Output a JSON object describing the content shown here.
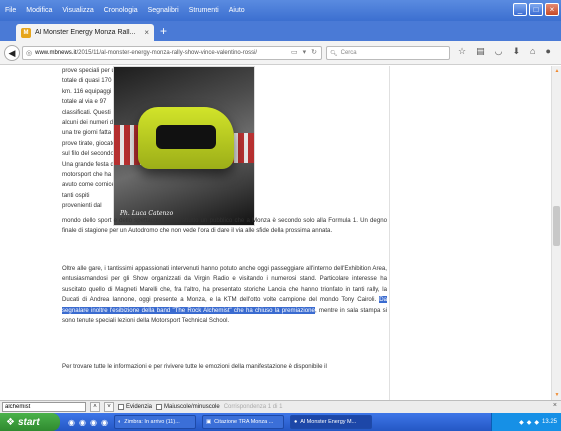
{
  "menu": {
    "items": [
      "File",
      "Modifica",
      "Visualizza",
      "Cronologia",
      "Segnalibri",
      "Strumenti",
      "Aiuto"
    ],
    "underline": [
      "F",
      "M",
      "V",
      "C",
      "S",
      "S",
      "A"
    ]
  },
  "tab": {
    "title": "Al Monster Energy Monza Rall...",
    "close": "×",
    "new_tab": "+"
  },
  "nav": {
    "url_host": "www.mbnews.it",
    "url_path": "/2015/11/al-monster-energy-monza-rally-show-vince-valentino-rossi/",
    "search_placeholder": "Cerca"
  },
  "article": {
    "side_lines": [
      "prove speciali per un",
      "totale di quasi 170",
      "km. 116 equipaggi in",
      "totale al via e 97",
      "classificati. Questi",
      "alcuni dei numeri di",
      "una tre giorni fatta di",
      "prove tirate, giocate",
      "sul filo del secondo.",
      "Una grande festa del",
      "motorsport che ha",
      "avuto come cornice",
      "tanti ospiti",
      "provenienti dal"
    ],
    "photo_credit": "Ph. Luca Catenzo",
    "para1": "mondo dello sport e dello spettacolo e soprattutto un pubblico che a Monza è secondo solo alla Formula 1. Un degno finale di stagione per un Autodromo che non vede l'ora di dare il via alle sfide della prossima annata.",
    "para2_before": "Oltre alle gare, i tantissimi appassionati intervenuti hanno potuto anche oggi passeggiare all'interno dell'Exhibition Area, entusiasmandosi per gli Show organizzati da Virgin Radio e visitando i numerosi stand. Particolare interesse ha suscitato quello di Magneti Marelli che, fra l'altro, ha presentato storiche Lancia che hanno trionfato in tanti rally, la Ducati di Andrea Iannone, oggi presente a Monza, e la KTM dell'otto volte campione del mondo Tony Cairoli. ",
    "para2_highlight": "Da segnalare inoltre l'esibizione della band \"The Rock Alchemist\" che ha chiuso la premiazione",
    "para2_after": ", mentre in sala stampa si sono tenute speciali lezioni della Motorsport Technical School.",
    "para3": "Per trovare tutte le informazioni e per rivivere tutte le emozioni della manifestazione è disponibile il"
  },
  "findbar": {
    "query": "alchemist",
    "prev": "˄",
    "next": "˅",
    "highlight_label": "Evidenzia",
    "case_label": "Maiuscole/minuscole",
    "count": "Corrispondenza 1 di 1",
    "close": "×"
  },
  "taskbar": {
    "start": "start",
    "tasks": [
      "Zimbra: In arrivo (11)...",
      "Citazione TRA Monza ...",
      "Al Monster Energy M..."
    ],
    "clock": "13.25"
  },
  "colors": {
    "highlight": "#3a6bd0",
    "taskbar": "#2457c4",
    "start": "#2f8a2f"
  }
}
